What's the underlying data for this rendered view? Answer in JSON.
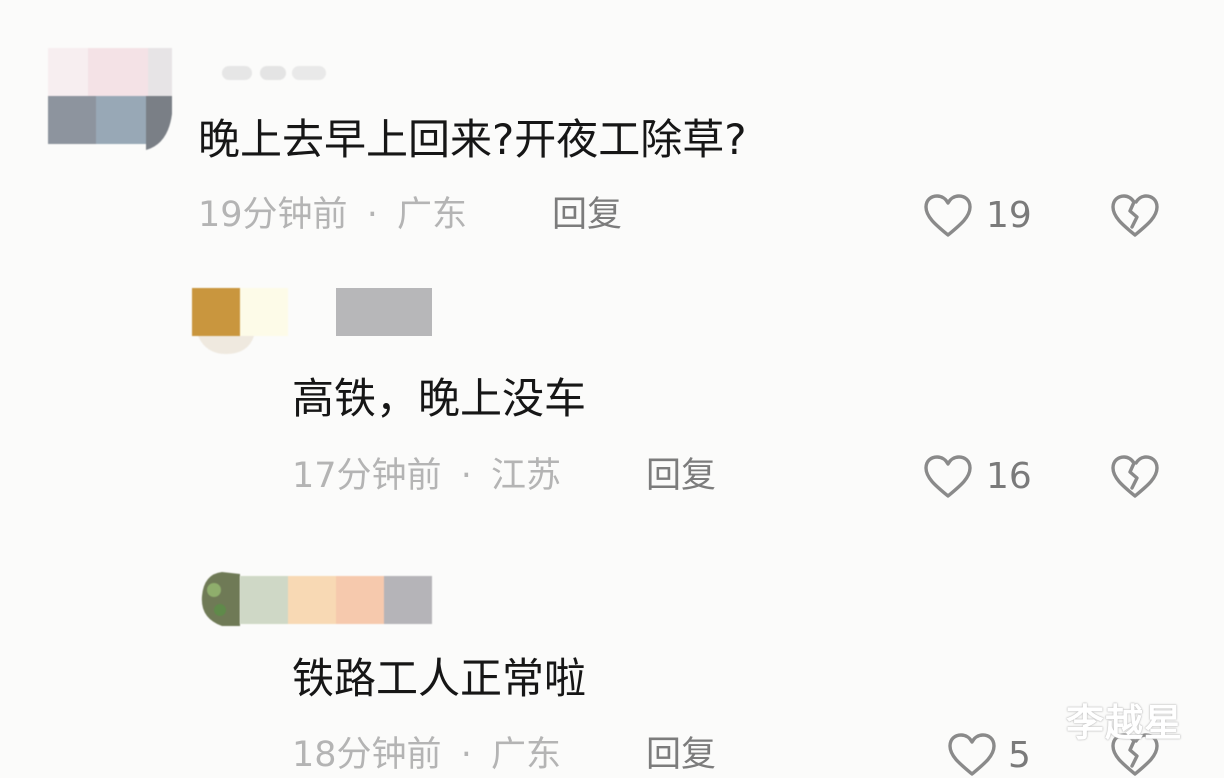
{
  "comments": [
    {
      "text": "晚上去早上回来?开夜工除草?",
      "time": "19分钟前",
      "location": "广东",
      "reply_label": "回复",
      "likes": "19"
    },
    {
      "text": "高铁，晚上没车",
      "time": "17分钟前",
      "location": "江苏",
      "reply_label": "回复",
      "likes": "16"
    },
    {
      "text": "铁路工人正常啦",
      "time": "18分钟前",
      "location": "广东",
      "reply_label": "回复",
      "likes": "5"
    }
  ],
  "separator": "·",
  "watermark": "李越星",
  "icons": {
    "like": "heart-outline-icon",
    "dislike": "broken-heart-icon"
  },
  "colors": {
    "background": "#fbfbfa",
    "text": "#161616",
    "meta": "#b4b4b4",
    "reply": "#7c7c7c",
    "icon": "#8a8a8a"
  }
}
